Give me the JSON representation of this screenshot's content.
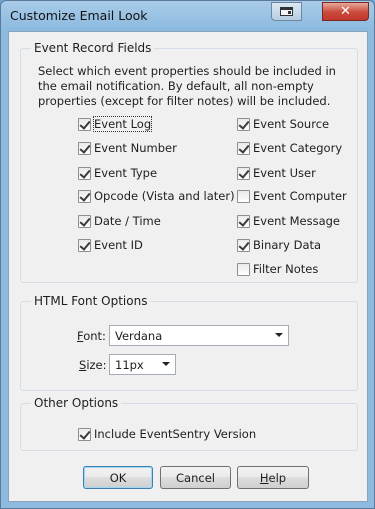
{
  "window": {
    "title": "Customize Email Look",
    "close_glyph": "✕",
    "restore_icon": "restore-window-icon"
  },
  "event_fields": {
    "legend": "Event Record Fields",
    "description": "Select which event properties should be included in the email notification. By default, all non-empty properties (except for filter notes) will be included.",
    "left": [
      {
        "label": "Event Log",
        "checked": true
      },
      {
        "label": "Event Number",
        "checked": true
      },
      {
        "label": "Event Type",
        "checked": true
      },
      {
        "label": "Opcode (Vista and later)",
        "checked": true
      },
      {
        "label": "Date / Time",
        "checked": true
      },
      {
        "label": "Event ID",
        "checked": true
      }
    ],
    "right": [
      {
        "label": "Event Source",
        "checked": true
      },
      {
        "label": "Event Category",
        "checked": true
      },
      {
        "label": "Event User",
        "checked": true
      },
      {
        "label": "Event Computer",
        "checked": false
      },
      {
        "label": "Event Message",
        "checked": true
      },
      {
        "label": "Binary Data",
        "checked": true
      },
      {
        "label": "Filter Notes",
        "checked": false
      }
    ]
  },
  "font_options": {
    "legend": "HTML Font Options",
    "font_label_accel": "F",
    "font_label_rest": "ont:",
    "font_value": "Verdana",
    "size_label_accel": "S",
    "size_label_rest": "ize:",
    "size_value": "11px"
  },
  "other_options": {
    "legend": "Other Options",
    "include_version_label": "Include EventSentry Version",
    "include_version_checked": true
  },
  "buttons": {
    "ok": "OK",
    "cancel": "Cancel",
    "help_accel": "H",
    "help_rest": "elp"
  }
}
